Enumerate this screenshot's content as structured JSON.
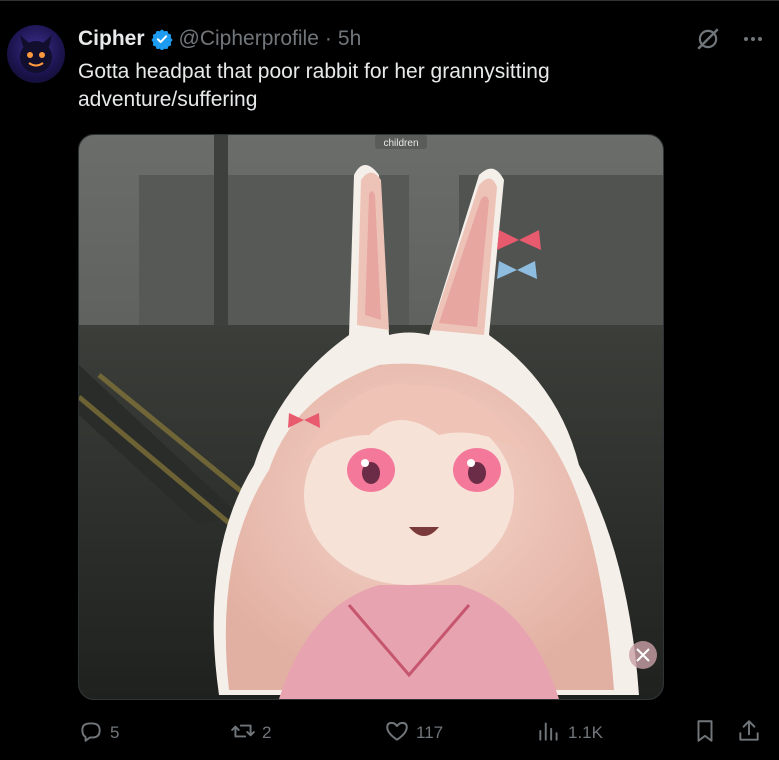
{
  "tweet": {
    "author_name": "Cipher",
    "handle": "@Cipherprofile",
    "separator": "·",
    "time": "5h",
    "text": "Gotta headpat that poor rabbit for her grannysitting adventure/suffering",
    "media_caption": "children"
  },
  "icons": {
    "verified": "verified-badge-icon",
    "grok": "grok-icon",
    "more": "more-icon",
    "reply": "reply-icon",
    "retweet": "retweet-icon",
    "like": "heart-icon",
    "views": "views-icon",
    "bookmark": "bookmark-icon",
    "share": "share-icon"
  },
  "actions": {
    "reply_count": "5",
    "retweet_count": "2",
    "like_count": "117",
    "views_count": "1.1K"
  },
  "colors": {
    "background": "#000000",
    "text": "#e7e9ea",
    "muted": "#71767b",
    "verified": "#1d9bf0"
  }
}
